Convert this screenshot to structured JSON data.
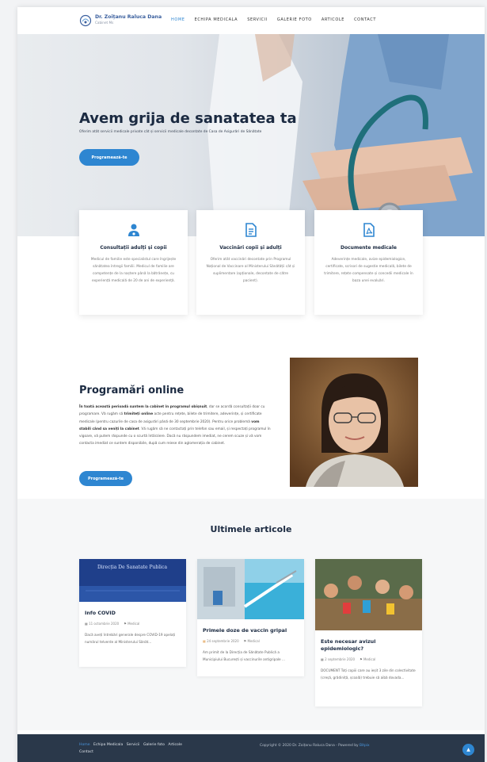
{
  "header": {
    "logo_title": "Dr. Zoițanu Raluca Dana",
    "logo_sub": "Cabinet Ms",
    "nav": [
      {
        "label": "Home",
        "active": true
      },
      {
        "label": "Echipa medicala",
        "active": false
      },
      {
        "label": "Servicii",
        "active": false
      },
      {
        "label": "Galerie foto",
        "active": false
      },
      {
        "label": "Articole",
        "active": false
      },
      {
        "label": "Contact",
        "active": false
      }
    ]
  },
  "hero": {
    "title": "Avem grija de sanatatea ta",
    "subtitle": "Oferim atât servicii medicale private cât și servicii medicale decontate de Casa de Asigurări de Sănătate",
    "button": "Programează-te"
  },
  "cards": [
    {
      "icon": "doctor-icon",
      "title": "Consultații adulți și copii",
      "text": "Medicul de familie este specialistul care îngrijește sănătatea întregii familii. Medicul de familie are competențe de la naștere până la bătrânețe, cu experiență medicală de 20 de ani de experiență."
    },
    {
      "icon": "document-icon",
      "title": "Vaccinări copii și adulți",
      "text": "Oferim atât vaccinări decontate prin Programul Național de Vaccinare al Ministerului Sănătății cât și suplimentare (opționale, decontate de către pacient)."
    },
    {
      "icon": "pdf-icon",
      "title": "Documente medicale",
      "text": "Adeverințe medicale, avize epidemiologice, certificate, scrisori de sugestie medicală, bilete de trimitere, rețete compensate și concedii medicale în baza unei evaluări."
    }
  ],
  "programari": {
    "title": "Programări online",
    "text_bold1": "În toată această perioadă suntem la cabinet în programul obișnuit",
    "text1": ", dar se acordă consultații doar cu programare. Vă rugăm să ",
    "text_bold2": "trimiteți online",
    "text2": " acte pentru rețete, bilete de trimitere, adeverințe, și certificate medicale (pentru cazurile de casa de asigurări până de 30 septembrie 2020). Pentru orice problemă ",
    "text_bold3": "vom stabili când sa veniți la cabinet",
    "text3": ". Vă rugăm să ne contactați prin telefon sau email, și respectați programul în vigoare, vă putem răspunde cu o scurtă întârziere. Dacă nu răspundem imediat, ne cerem scuze și vă vom contacta imediat ce suntem disponibile, după cum reiese din aglomerația de cabinet.",
    "button": "Programează-te"
  },
  "articles": {
    "title": "Ultimele articole",
    "items": [
      {
        "thumb_text": "Direcția De Sanatate Publica",
        "title": "Info COVID",
        "date": "11 octombrie 2020",
        "category": "Medical",
        "excerpt": "Dacă aveți întrebări generale despre COVID-19 apelați numărul telverde al Ministerului Sănăt..."
      },
      {
        "thumb_text": "",
        "title": "Primele doze de vaccin gripal",
        "date": "24 septembrie 2020",
        "category": "Medical",
        "excerpt": "Am primit de la Direcția de Sănătate Publică a Municipiului București și vaccinurile antigripale ..."
      },
      {
        "thumb_text": "",
        "title": "Este necesar avizul epidemiologic?",
        "date": "2 septembrie 2020",
        "category": "Medical",
        "excerpt": "DOCUMENT Toți copiii care au ieșit 3 zile din colectivitate (creșă, grădiniță, școală) trebuie să aibă dovada..."
      }
    ]
  },
  "footer": {
    "nav": [
      {
        "label": "Home",
        "active": true
      },
      {
        "label": "Echipa Medicala",
        "active": false
      },
      {
        "label": "Servicii",
        "active": false
      },
      {
        "label": "Galerie foto",
        "active": false
      },
      {
        "label": "Articole",
        "active": false
      },
      {
        "label": "Contact",
        "active": false
      }
    ],
    "copyright": "Copyright © 2020 Dr. Zoițanu Raluca Dana - Powered by ",
    "brand": "Bitpix",
    "totop": "▲"
  }
}
